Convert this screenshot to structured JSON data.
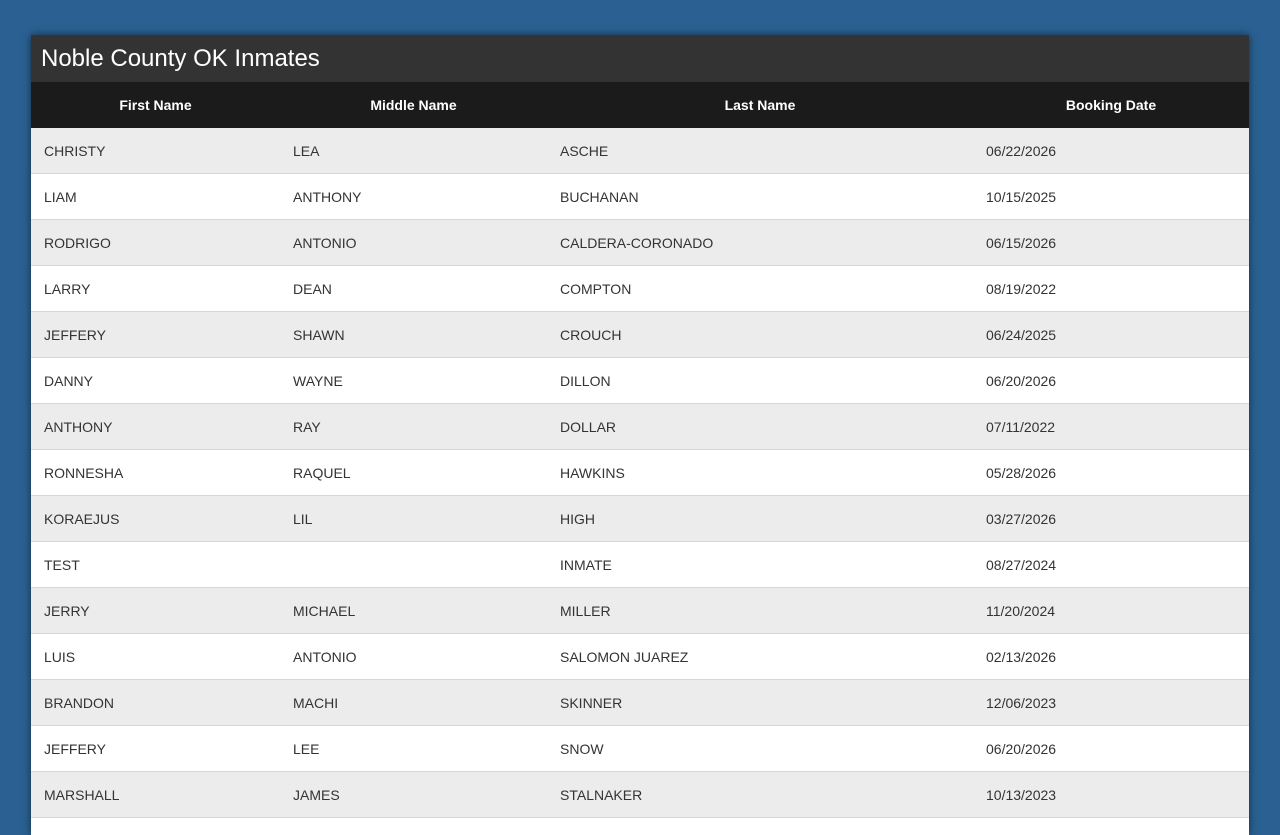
{
  "page": {
    "title": "Noble County OK Inmates"
  },
  "table": {
    "headers": [
      "First Name",
      "Middle Name",
      "Last Name",
      "Booking Date"
    ],
    "rows": [
      [
        "CHRISTY",
        "LEA",
        "ASCHE",
        "06/22/2026"
      ],
      [
        "LIAM",
        "ANTHONY",
        "BUCHANAN",
        "10/15/2025"
      ],
      [
        "RODRIGO",
        "ANTONIO",
        "CALDERA-CORONADO",
        "06/15/2026"
      ],
      [
        "LARRY",
        "DEAN",
        "COMPTON",
        "08/19/2022"
      ],
      [
        "JEFFERY",
        "SHAWN",
        "CROUCH",
        "06/24/2025"
      ],
      [
        "DANNY",
        "WAYNE",
        "DILLON",
        "06/20/2026"
      ],
      [
        "ANTHONY",
        "RAY",
        "DOLLAR",
        "07/11/2022"
      ],
      [
        "RONNESHA",
        "RAQUEL",
        "HAWKINS",
        "05/28/2026"
      ],
      [
        "KORAEJUS",
        "LIL",
        "HIGH",
        "03/27/2026"
      ],
      [
        "TEST",
        "",
        "INMATE",
        "08/27/2024"
      ],
      [
        "JERRY",
        "MICHAEL",
        "MILLER",
        "11/20/2024"
      ],
      [
        "LUIS",
        "ANTONIO",
        "SALOMON JUAREZ",
        "02/13/2026"
      ],
      [
        "BRANDON",
        "MACHI",
        "SKINNER",
        "12/06/2023"
      ],
      [
        "JEFFERY",
        "LEE",
        "SNOW",
        "06/20/2026"
      ],
      [
        "MARSHALL",
        "JAMES",
        "STALNAKER",
        "10/13/2023"
      ]
    ]
  },
  "colors": {
    "background": "#2a6192",
    "title_bar": "#333333",
    "header_row": "#1b1b1b",
    "row_odd": "#ececec",
    "row_even": "#ffffff"
  }
}
